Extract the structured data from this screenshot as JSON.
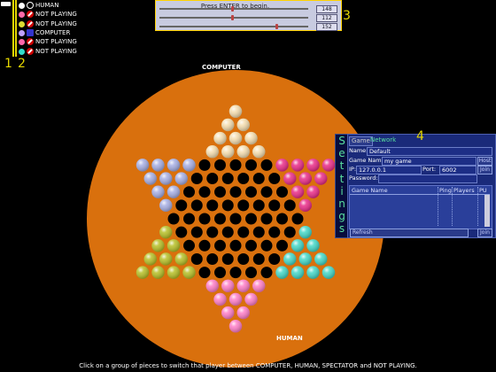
{
  "players": [
    {
      "color": "#ffffff",
      "status": "human",
      "label": "HUMAN"
    },
    {
      "color": "#ff6aa8",
      "status": "not_playing",
      "label": "NOT PLAYING"
    },
    {
      "color": "#dddd33",
      "status": "not_playing",
      "label": "NOT PLAYING"
    },
    {
      "color": "#c0a0ff",
      "status": "computer",
      "label": "COMPUTER"
    },
    {
      "color": "#ff66aa",
      "status": "not_playing",
      "label": "NOT PLAYING"
    },
    {
      "color": "#33ddcc",
      "status": "not_playing",
      "label": "NOT PLAYING"
    }
  ],
  "callouts": {
    "one": "1",
    "two": "2",
    "three": "3",
    "four": "4"
  },
  "status_bar": {
    "message": "Press ENTER to begin.",
    "values": [
      "148",
      "112",
      "152"
    ],
    "marker_levels": [
      0.48,
      0.48,
      0.78
    ]
  },
  "board": {
    "computer_label": "COMPUTER",
    "human_label": "HUMAN",
    "colors": {
      "board": "#d9700d",
      "hole": "#000000",
      "top_pieces": "#f5deb0",
      "top_left_pieces": "#a6aee4",
      "top_right_pieces": "#ea2c88",
      "bottom_left_pieces": "#b7c026",
      "bottom_right_pieces": "#ff6bd0",
      "bottom_pieces": "#ff7ec8",
      "right_pieces": "#44d8c8"
    }
  },
  "settings": {
    "tab_letters": [
      "S",
      "e",
      "t",
      "t",
      "i",
      "n",
      "g",
      "s"
    ],
    "tab_game": "Game",
    "tab_network": "Network",
    "name_label": "Name:",
    "name_value": "Default",
    "game_name_label": "Game Name:",
    "game_name_value": "my game",
    "host_button": "Host",
    "ip_label": "IP:",
    "ip_value": "127.0.0.1",
    "port_label": "Port:",
    "port_value": "6002",
    "join_button": "Join",
    "password_label": "Password:",
    "password_value": "",
    "list_headers": {
      "game_name": "Game Name",
      "ping": "Ping",
      "players": "Players",
      "pu": "PU"
    },
    "refresh_button": "Refresh",
    "join_list_button": "Join"
  },
  "footer": "Click on a group of pieces to switch that player between COMPUTER, HUMAN, SPECTATOR and NOT PLAYING."
}
